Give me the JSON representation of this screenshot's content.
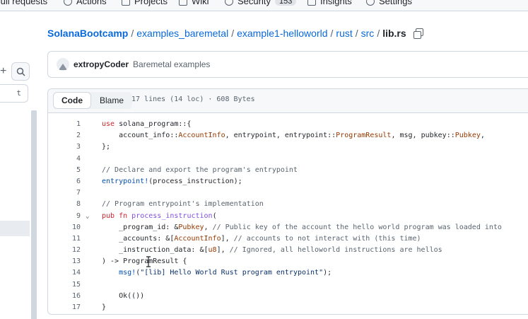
{
  "nav": {
    "items": [
      {
        "label": "Pull requests",
        "icon": "pull-request-icon"
      },
      {
        "label": "Actions",
        "icon": "play-icon"
      },
      {
        "label": "Projects",
        "icon": "table-icon"
      },
      {
        "label": "Wiki",
        "icon": "book-icon"
      },
      {
        "label": "Security",
        "icon": "shield-icon",
        "counter": "153"
      },
      {
        "label": "Insights",
        "icon": "graph-icon"
      },
      {
        "label": "Settings",
        "icon": "gear-icon"
      }
    ]
  },
  "sidebar": {
    "add_icon": "plus-icon",
    "search_icon": "search-icon",
    "filter_shortcut": "t"
  },
  "breadcrumb": {
    "parts": [
      "SolanaBootcamp",
      "examples_baremetal",
      "example1-helloworld",
      "rust",
      "src"
    ],
    "current": "lib.rs",
    "separator": "/"
  },
  "commit": {
    "author": "extropyCoder",
    "message": "Baremetal examples"
  },
  "file": {
    "tabs": {
      "code": "Code",
      "blame": "Blame"
    },
    "meta": "17 lines (14 loc) · 608 Bytes"
  },
  "code_lines": [
    {
      "n": "1",
      "text": "use solana_program::{"
    },
    {
      "n": "2",
      "text": "    account_info::AccountInfo, entrypoint, entrypoint::ProgramResult, msg, pubkey::Pubkey,"
    },
    {
      "n": "3",
      "text": "};"
    },
    {
      "n": "4",
      "text": ""
    },
    {
      "n": "5",
      "text": "// Declare and export the program's entrypoint"
    },
    {
      "n": "6",
      "text": "entrypoint!(process_instruction);"
    },
    {
      "n": "7",
      "text": ""
    },
    {
      "n": "8",
      "text": "// Program entrypoint's implementation"
    },
    {
      "n": "9",
      "text": "pub fn process_instruction(",
      "fold": "⌄"
    },
    {
      "n": "10",
      "text": "    _program_id: &Pubkey, // Public key of the account the hello world program was loaded into"
    },
    {
      "n": "11",
      "text": "    _accounts: &[AccountInfo], // accounts to not interact with (this time)"
    },
    {
      "n": "12",
      "text": "    _instruction_data: &[u8], // Ignored, all helloworld instructions are hellos"
    },
    {
      "n": "13",
      "text": ") -> ProgramResult {"
    },
    {
      "n": "14",
      "text": "    msg!(\"[lib] Hello World Rust program entrypoint\");"
    },
    {
      "n": "15",
      "text": ""
    },
    {
      "n": "16",
      "text": "    Ok(())"
    },
    {
      "n": "17",
      "text": "}"
    }
  ],
  "colors": {
    "link": "#0969da",
    "keyword": "#cf222e",
    "function": "#8250df",
    "type": "#953800",
    "comment": "#59636e",
    "string": "#0a3069",
    "macro": "#0550ae"
  }
}
